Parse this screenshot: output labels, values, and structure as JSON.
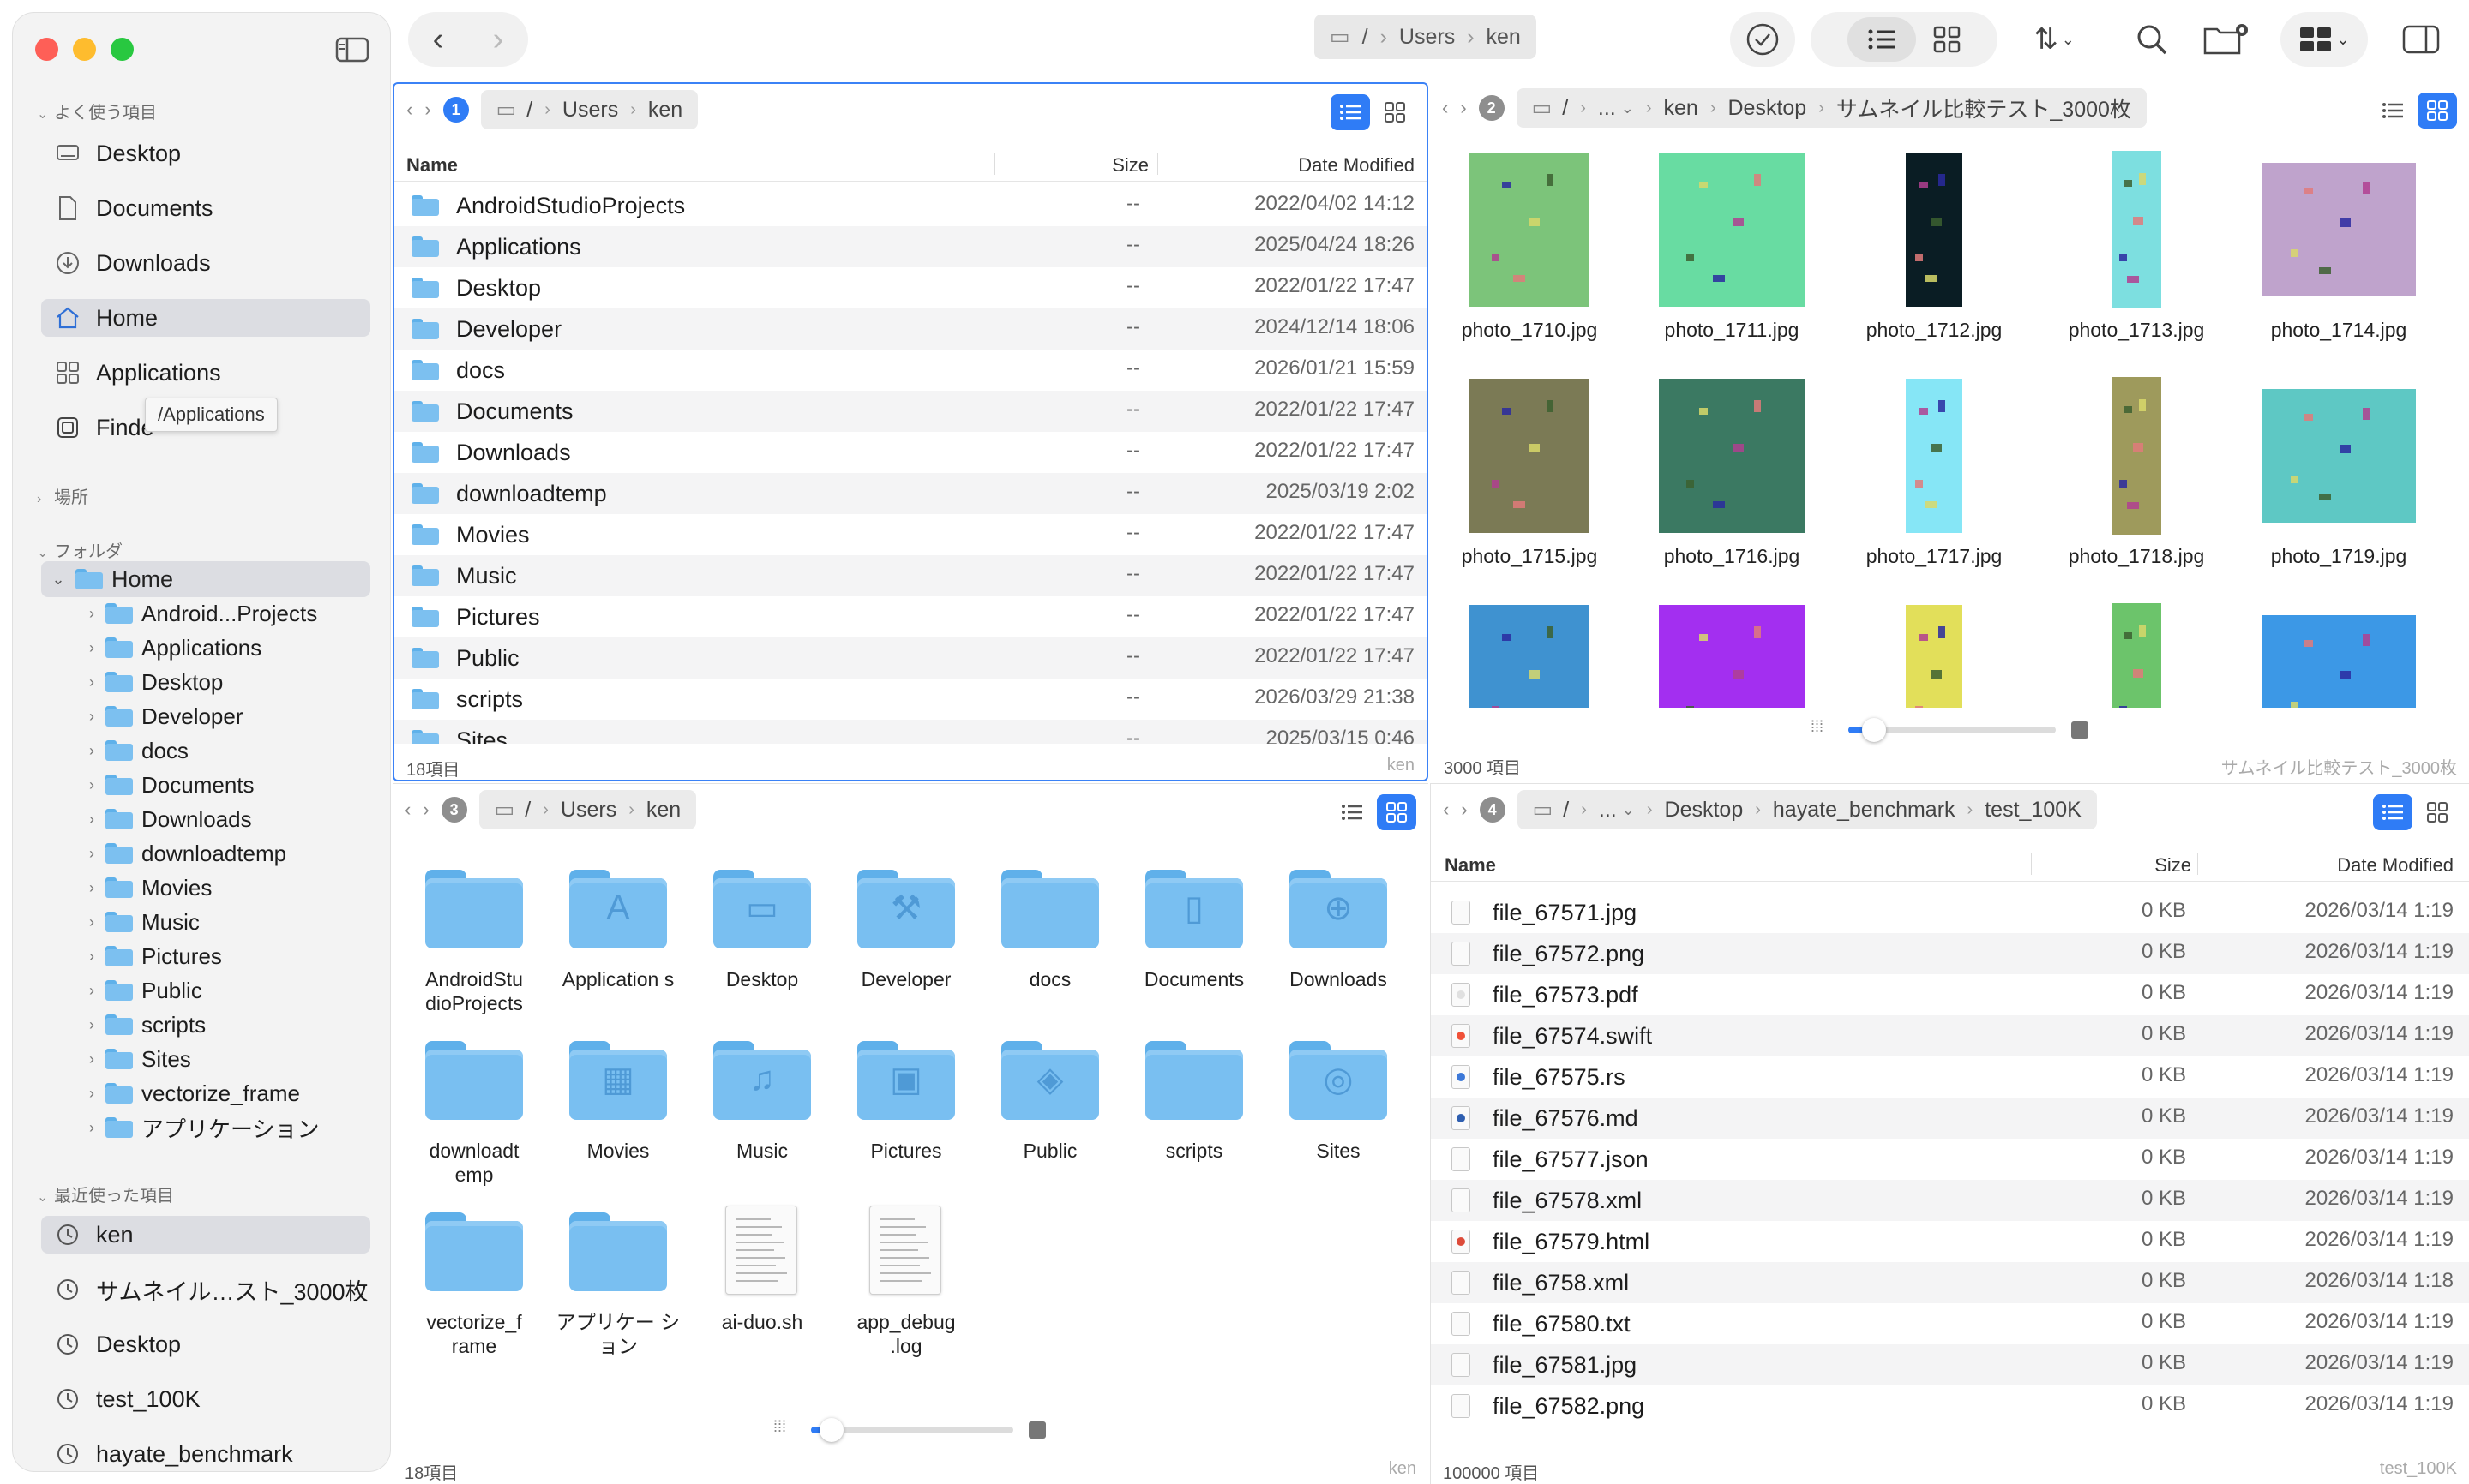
{
  "sidebar": {
    "favorites_header": "よく使う項目",
    "favorites": [
      {
        "label": "Desktop",
        "icon": "desktop-icon"
      },
      {
        "label": "Documents",
        "icon": "document-icon"
      },
      {
        "label": "Downloads",
        "icon": "download-icon"
      },
      {
        "label": "Home",
        "icon": "home-icon",
        "selected": true
      },
      {
        "label": "Applications",
        "icon": "apps-icon"
      },
      {
        "label": "Finde",
        "icon": "finder-icon"
      }
    ],
    "tooltip": "/Applications",
    "locations_header": "場所",
    "folders_header": "フォルダ",
    "tree_root": "Home",
    "tree": [
      "Android...Projects",
      "Applications",
      "Desktop",
      "Developer",
      "docs",
      "Documents",
      "Downloads",
      "downloadtemp",
      "Movies",
      "Music",
      "Pictures",
      "Public",
      "scripts",
      "Sites",
      "vectorize_frame",
      "アプリケーション"
    ],
    "recent_header": "最近使った項目",
    "recent": [
      "ken",
      "サムネイル…スト_3000枚",
      "Desktop",
      "test_100K",
      "hayate_benchmark"
    ]
  },
  "toolbar": {
    "path": [
      "/",
      "Users",
      "ken"
    ]
  },
  "pane1": {
    "number": "1",
    "crumbs": [
      "/",
      "Users",
      "ken"
    ],
    "headers": {
      "name": "Name",
      "size": "Size",
      "date": "Date Modified"
    },
    "rows": [
      {
        "name": "AndroidStudioProjects",
        "size": "--",
        "date": "2022/04/02 14:12"
      },
      {
        "name": "Applications",
        "size": "--",
        "date": "2025/04/24 18:26"
      },
      {
        "name": "Desktop",
        "size": "--",
        "date": "2022/01/22 17:47"
      },
      {
        "name": "Developer",
        "size": "--",
        "date": "2024/12/14 18:06"
      },
      {
        "name": "docs",
        "size": "--",
        "date": "2026/01/21 15:59"
      },
      {
        "name": "Documents",
        "size": "--",
        "date": "2022/01/22 17:47"
      },
      {
        "name": "Downloads",
        "size": "--",
        "date": "2022/01/22 17:47"
      },
      {
        "name": "downloadtemp",
        "size": "--",
        "date": "2025/03/19 2:02"
      },
      {
        "name": "Movies",
        "size": "--",
        "date": "2022/01/22 17:47"
      },
      {
        "name": "Music",
        "size": "--",
        "date": "2022/01/22 17:47"
      },
      {
        "name": "Pictures",
        "size": "--",
        "date": "2022/01/22 17:47"
      },
      {
        "name": "Public",
        "size": "--",
        "date": "2022/01/22 17:47"
      },
      {
        "name": "scripts",
        "size": "--",
        "date": "2026/03/29 21:38"
      },
      {
        "name": "Sites",
        "size": "--",
        "date": "2025/03/15 0:46"
      }
    ],
    "status_left": "18項目",
    "status_right": "ken"
  },
  "pane2": {
    "number": "2",
    "crumbs": [
      "/",
      "...",
      "ken",
      "Desktop",
      "サムネイル比較テスト_3000枚"
    ],
    "thumbs": [
      {
        "name": "photo_1710.jpg",
        "color": "#7cc47a"
      },
      {
        "name": "photo_1711.jpg",
        "color": "#68dca2"
      },
      {
        "name": "photo_1712.jpg",
        "color": "#0a1d24"
      },
      {
        "name": "photo_1713.jpg",
        "color": "#7ddfe0"
      },
      {
        "name": "photo_1714.jpg",
        "color": "#bfa3cc"
      },
      {
        "name": "photo_1715.jpg",
        "color": "#7b7a55"
      },
      {
        "name": "photo_1716.jpg",
        "color": "#3b7962"
      },
      {
        "name": "photo_1717.jpg",
        "color": "#86e6f6"
      },
      {
        "name": "photo_1718.jpg",
        "color": "#9e9a5c"
      },
      {
        "name": "photo_1719.jpg",
        "color": "#5ec8c4"
      },
      {
        "name": "",
        "color": "#3f92d0"
      },
      {
        "name": "",
        "color": "#a32ff0"
      },
      {
        "name": "",
        "color": "#e2df5a"
      },
      {
        "name": "",
        "color": "#6cc46b"
      },
      {
        "name": "",
        "color": "#3c98e6"
      }
    ],
    "status_left": "3000 項目",
    "status_right": "サムネイル比較テスト_3000枚"
  },
  "pane3": {
    "number": "3",
    "crumbs": [
      "/",
      "Users",
      "ken"
    ],
    "icons": [
      {
        "label": "AndroidStu dioProjects",
        "glyph": ""
      },
      {
        "label": "Application s",
        "glyph": "A"
      },
      {
        "label": "Desktop",
        "glyph": "▭"
      },
      {
        "label": "Developer",
        "glyph": "⚒"
      },
      {
        "label": "docs",
        "glyph": ""
      },
      {
        "label": "Documents",
        "glyph": "▯"
      },
      {
        "label": "Downloads",
        "glyph": "⊕"
      },
      {
        "label": "downloadt emp",
        "glyph": ""
      },
      {
        "label": "Movies",
        "glyph": "▦"
      },
      {
        "label": "Music",
        "glyph": "♫"
      },
      {
        "label": "Pictures",
        "glyph": "▣"
      },
      {
        "label": "Public",
        "glyph": "◈"
      },
      {
        "label": "scripts",
        "glyph": ""
      },
      {
        "label": "Sites",
        "glyph": "◎"
      },
      {
        "label": "vectorize_f rame",
        "glyph": ""
      },
      {
        "label": "アプリケー ション",
        "glyph": ""
      },
      {
        "label": "ai-duo.sh",
        "glyph": "doc"
      },
      {
        "label": "app_debug .log",
        "glyph": "doc"
      }
    ],
    "status_left": "18項目",
    "status_right": "ken"
  },
  "pane4": {
    "number": "4",
    "crumbs": [
      "/",
      "...",
      "Desktop",
      "hayate_benchmark",
      "test_100K"
    ],
    "headers": {
      "name": "Name",
      "size": "Size",
      "date": "Date Modified"
    },
    "rows": [
      {
        "name": "file_67571.jpg",
        "size": "0 KB",
        "date": "2026/03/14 1:19",
        "icon": "image-file-icon"
      },
      {
        "name": "file_67572.png",
        "size": "0 KB",
        "date": "2026/03/14 1:19",
        "icon": "image-file-icon"
      },
      {
        "name": "file_67573.pdf",
        "size": "0 KB",
        "date": "2026/03/14 1:19",
        "icon": "pdf-file-icon"
      },
      {
        "name": "file_67574.swift",
        "size": "0 KB",
        "date": "2026/03/14 1:19",
        "icon": "swift-file-icon"
      },
      {
        "name": "file_67575.rs",
        "size": "0 KB",
        "date": "2026/03/14 1:19",
        "icon": "code-file-icon"
      },
      {
        "name": "file_67576.md",
        "size": "0 KB",
        "date": "2026/03/14 1:19",
        "icon": "markdown-file-icon"
      },
      {
        "name": "file_67577.json",
        "size": "0 KB",
        "date": "2026/03/14 1:19",
        "icon": "text-file-icon"
      },
      {
        "name": "file_67578.xml",
        "size": "0 KB",
        "date": "2026/03/14 1:19",
        "icon": "text-file-icon"
      },
      {
        "name": "file_67579.html",
        "size": "0 KB",
        "date": "2026/03/14 1:19",
        "icon": "html-file-icon"
      },
      {
        "name": "file_6758.xml",
        "size": "0 KB",
        "date": "2026/03/14 1:18",
        "icon": "text-file-icon"
      },
      {
        "name": "file_67580.txt",
        "size": "0 KB",
        "date": "2026/03/14 1:19",
        "icon": "text-file-icon"
      },
      {
        "name": "file_67581.jpg",
        "size": "0 KB",
        "date": "2026/03/14 1:19",
        "icon": "image-file-icon"
      },
      {
        "name": "file_67582.png",
        "size": "0 KB",
        "date": "2026/03/14 1:19",
        "icon": "image-file-icon"
      }
    ],
    "status_left": "100000 項目",
    "status_right": "test_100K"
  }
}
